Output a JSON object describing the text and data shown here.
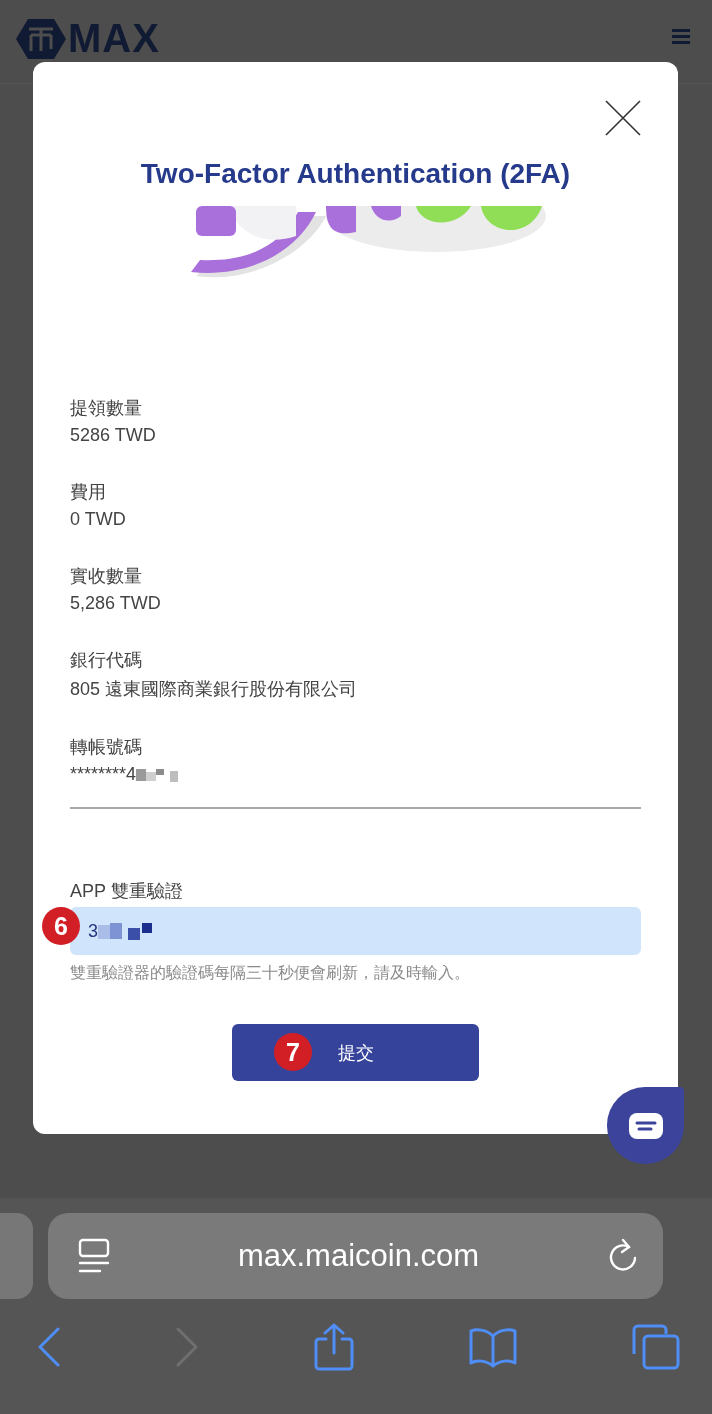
{
  "header": {
    "logo_text": "MAX"
  },
  "modal": {
    "title": "Two-Factor Authentication (2FA)",
    "fields": [
      {
        "kind": "text",
        "label": "提領數量",
        "value": "5286 TWD"
      },
      {
        "kind": "text",
        "label": "費用",
        "value": "0 TWD"
      },
      {
        "kind": "text",
        "label": "實收數量",
        "value": "5,286 TWD"
      },
      {
        "kind": "text",
        "label": "銀行代碼",
        "value": "805 遠東國際商業銀行股份有限公司"
      },
      {
        "kind": "masked",
        "label": "轉帳號碼",
        "value": "********4"
      }
    ],
    "otp": {
      "label": "APP 雙重驗證",
      "value": "3",
      "hint": "雙重驗證器的驗證碼每隔三十秒便會刷新，請及時輸入。",
      "marker": "6"
    },
    "submit": {
      "label": "提交",
      "marker": "7"
    }
  },
  "browser": {
    "url": "max.maicoin.com",
    "back_enabled": true,
    "forward_enabled": false
  }
}
